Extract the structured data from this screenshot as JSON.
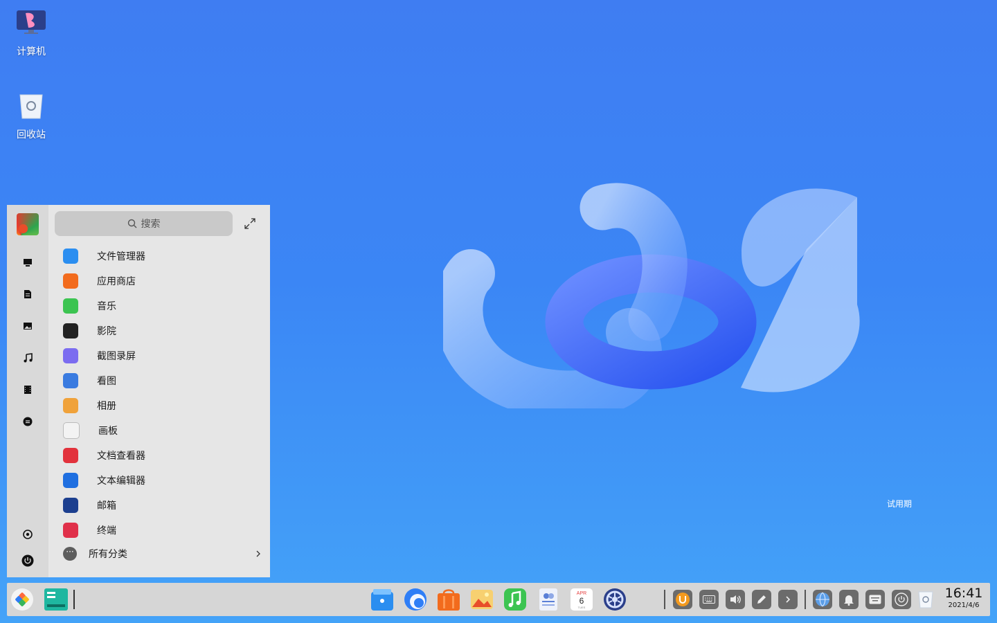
{
  "desktop": {
    "icons": [
      {
        "label": "计算机",
        "icon": "computer-icon"
      },
      {
        "label": "回收站",
        "icon": "trash-icon"
      }
    ],
    "watermark": "试用期"
  },
  "start_menu": {
    "search_placeholder": "搜索",
    "apps": [
      {
        "label": "文件管理器",
        "icon": "file-manager-icon",
        "color": "#2b8ef0"
      },
      {
        "label": "应用商店",
        "icon": "app-store-icon",
        "color": "#f26b1d"
      },
      {
        "label": "音乐",
        "icon": "music-icon",
        "color": "#3cc451"
      },
      {
        "label": "影院",
        "icon": "movie-icon",
        "color": "#222222"
      },
      {
        "label": "截图录屏",
        "icon": "screenshot-icon",
        "color": "#7b6cf0"
      },
      {
        "label": "看图",
        "icon": "image-viewer-icon",
        "color": "#3a7be0"
      },
      {
        "label": "相册",
        "icon": "album-icon",
        "color": "#f0a23a"
      },
      {
        "label": "画板",
        "icon": "draw-icon",
        "color": "#f3f3f3"
      },
      {
        "label": "文档查看器",
        "icon": "document-viewer-icon",
        "color": "#e2323c"
      },
      {
        "label": "文本编辑器",
        "icon": "text-editor-icon",
        "color": "#1f6fe0"
      },
      {
        "label": "邮箱",
        "icon": "mail-icon",
        "color": "#1c3f8f"
      },
      {
        "label": "终端",
        "icon": "terminal-icon",
        "color": "#e0304a"
      }
    ],
    "all_categories": "所有分类",
    "sidebar_icons": [
      "computer-icon",
      "document-icon",
      "picture-icon",
      "music-note-icon",
      "video-icon",
      "download-icon",
      "settings-icon",
      "power-icon"
    ]
  },
  "taskbar": {
    "pinned": [
      "file-manager-icon",
      "browser-icon",
      "app-store-icon",
      "album-icon",
      "music-icon",
      "contacts-icon",
      "calendar-icon",
      "settings-icon"
    ],
    "calendar": {
      "month": "APR",
      "day": "6",
      "weekday": "TUES"
    },
    "tray": [
      "input-method-icon",
      "keyboard-icon",
      "volume-icon",
      "pen-icon",
      "chevron-right-icon",
      "network-icon",
      "notification-bell-icon",
      "onboard-keyboard-icon",
      "power-icon",
      "trash-icon"
    ],
    "clock": {
      "time": "16:41",
      "date": "2021/4/6"
    }
  }
}
